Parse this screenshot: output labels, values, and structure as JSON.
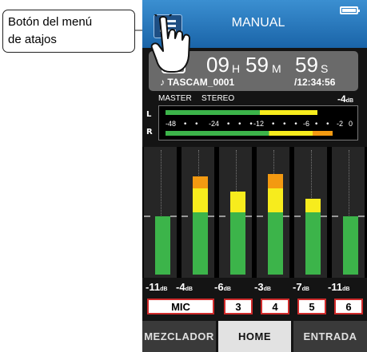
{
  "callout": {
    "line1": "Botón del menú",
    "line2": "de atajos"
  },
  "title": "MANUAL",
  "time": {
    "hours": "09",
    "hours_unit": "H",
    "minutes": "59",
    "minutes_unit": "M",
    "seconds": "59",
    "seconds_unit": "S",
    "file_name": "♪ TASCAM_0001",
    "total_time": "/12:34:56"
  },
  "master": {
    "label": "MASTER",
    "mode": "STEREO",
    "level_value": "-4",
    "level_unit": "dB",
    "scale": [
      "-48",
      "-24",
      "-12",
      "-6",
      "-2",
      "0"
    ],
    "left_label": "L",
    "right_label": "R",
    "left_level_fraction": 0.82,
    "right_level_fraction": 0.9
  },
  "channels": [
    {
      "level": "-11",
      "unit": "dB",
      "button": "MIC",
      "meter_fraction": 0.52
    },
    {
      "level": "-4",
      "unit": "dB",
      "button": "3",
      "meter_fraction": 0.88
    },
    {
      "level": "-6",
      "unit": "dB",
      "button": "4",
      "meter_fraction": 0.74
    },
    {
      "level": "-3",
      "unit": "dB",
      "button": "5",
      "meter_fraction": 0.9
    },
    {
      "level": "-7",
      "unit": "dB",
      "button": "6",
      "meter_fraction": 0.68
    },
    {
      "level": "-11",
      "unit": "dB",
      "meter_fraction": 0.52
    }
  ],
  "tabs": [
    "MEZCLADOR",
    "HOME",
    "ENTRADA"
  ],
  "colors": {
    "accent_blue": "#2a7cc4",
    "meter_green": "#3cb44a",
    "meter_yellow": "#f7ec1d",
    "meter_orange": "#f39a11",
    "button_border": "#d02b2b"
  },
  "icons": [
    "shortcut-menu-icon",
    "battery-icon",
    "record-mode-icon",
    "hand-pointer-icon"
  ]
}
